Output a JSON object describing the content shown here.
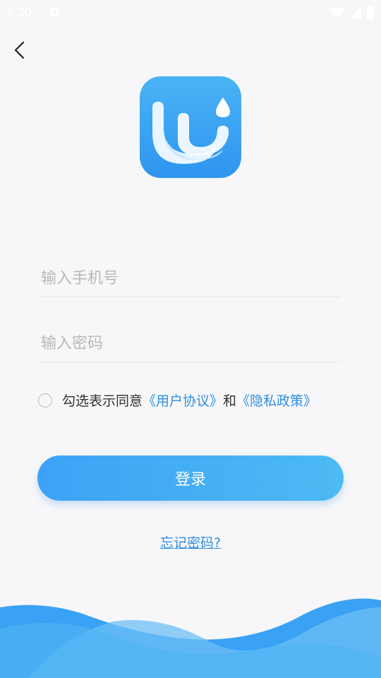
{
  "status_bar": {
    "time": "6:20"
  },
  "login": {
    "phone_placeholder": "输入手机号",
    "password_placeholder": "输入密码",
    "agree_prefix": "勾选表示同意",
    "user_agreement": "《用户协议》",
    "conjunction": "和",
    "privacy_policy": "《隐私政策》",
    "login_button": "登录",
    "forgot_password": "忘记密码?"
  },
  "colors": {
    "accent": "#3da2f6",
    "link": "#2f8fe0",
    "background": "#f7f7f9"
  },
  "icons": [
    "back-arrow-icon",
    "app-logo-icon",
    "wifi-icon",
    "signal-icon",
    "battery-icon"
  ]
}
